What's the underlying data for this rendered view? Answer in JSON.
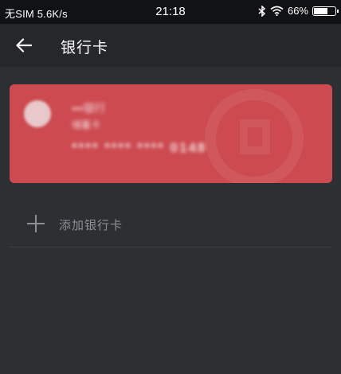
{
  "status_bar": {
    "carrier": "无SIM",
    "speed": "5.6K/s",
    "time": "21:18",
    "battery": "66%",
    "battery_level": 0.66,
    "icons": [
      "bluetooth-icon",
      "wifi-icon",
      "battery-icon"
    ]
  },
  "header": {
    "title": "银行卡",
    "back_icon": "arrow-left-icon"
  },
  "bank_card": {
    "bank_name": "•••银行",
    "card_type": "储蓄卡",
    "card_number": "**** **** **** 0148",
    "color": "#cc4a50"
  },
  "add_card": {
    "label": "添加银行卡",
    "icon": "plus-icon"
  },
  "colors": {
    "background": "#2e2f33",
    "app_bar": "#26272b",
    "status_bar": "#111214",
    "muted_text": "#8e8f94"
  }
}
